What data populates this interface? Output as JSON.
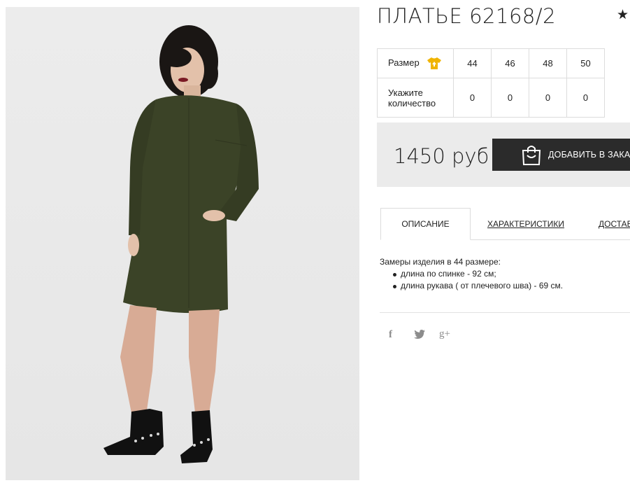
{
  "product": {
    "title": "ПЛАТЬЕ 62168/2",
    "favorite_icon": "star-icon"
  },
  "sizes": {
    "size_label": "Размер",
    "size_icon": "tshirt-size-icon",
    "qty_label": "Укажите количество",
    "columns": [
      {
        "size": "44",
        "qty": "0"
      },
      {
        "size": "46",
        "qty": "0"
      },
      {
        "size": "48",
        "qty": "0"
      },
      {
        "size": "50",
        "qty": "0"
      }
    ]
  },
  "price": {
    "value": "1450 руб",
    "add_button": "ДОБАВИТЬ В ЗАКАЗ",
    "bag_icon": "shopping-bag-icon"
  },
  "tabs": [
    {
      "label": "ОПИСАНИЕ",
      "active": true
    },
    {
      "label": "ХАРАКТЕРИСТИКИ",
      "active": false
    },
    {
      "label": "ДОСТАВКА",
      "active": false
    }
  ],
  "description": {
    "intro": "Замеры изделия в 44 размере:",
    "items": [
      "длина по спинке - 92 см;",
      "длина рукава ( от плечевого шва) - 69 см."
    ]
  },
  "social": {
    "facebook": "f",
    "twitter": "twitter-icon",
    "googleplus": "g+"
  },
  "colors": {
    "dress": "#3b4327",
    "button": "#2b2b2b",
    "price_bg": "#ebebeb",
    "size_icon": "#f0b400"
  }
}
